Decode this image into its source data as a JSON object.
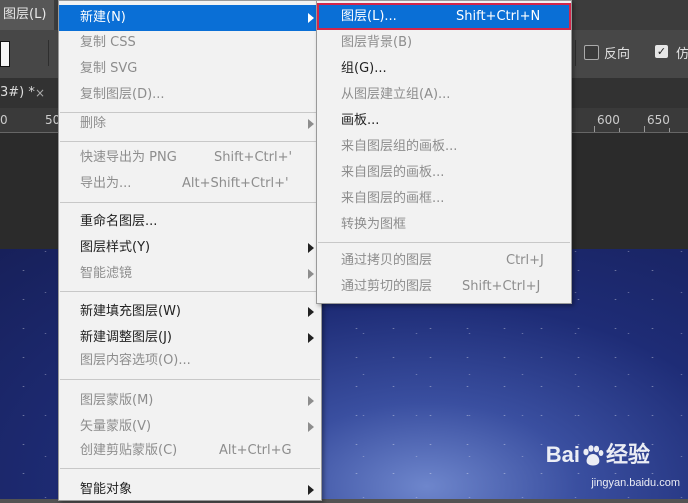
{
  "menubar": {
    "layer_menu": "图层(L)"
  },
  "options_bar": {
    "reverse_label": "反向",
    "imitate_label": "仿"
  },
  "document_tab": {
    "title": "3#) *",
    "close": "×"
  },
  "ruler": {
    "labels": [
      "0",
      "50",
      "600",
      "650"
    ]
  },
  "main_menu": {
    "items": [
      {
        "label": "新建(N)",
        "shortcut": "",
        "submenu": true,
        "disabled": false
      },
      {
        "label": "复制 CSS",
        "shortcut": "",
        "submenu": false,
        "disabled": true
      },
      {
        "label": "复制 SVG",
        "shortcut": "",
        "submenu": false,
        "disabled": true
      },
      {
        "label": "复制图层(D)...",
        "shortcut": "",
        "submenu": false,
        "disabled": true
      },
      {
        "label": "删除",
        "shortcut": "",
        "submenu": true,
        "disabled": true
      },
      {
        "label": "快速导出为 PNG",
        "shortcut": "Shift+Ctrl+'",
        "submenu": false,
        "disabled": true
      },
      {
        "label": "导出为...",
        "shortcut": "Alt+Shift+Ctrl+'",
        "submenu": false,
        "disabled": true
      },
      {
        "label": "重命名图层...",
        "shortcut": "",
        "submenu": false,
        "disabled": false
      },
      {
        "label": "图层样式(Y)",
        "shortcut": "",
        "submenu": true,
        "disabled": false
      },
      {
        "label": "智能滤镜",
        "shortcut": "",
        "submenu": true,
        "disabled": true
      },
      {
        "label": "新建填充图层(W)",
        "shortcut": "",
        "submenu": true,
        "disabled": false
      },
      {
        "label": "新建调整图层(J)",
        "shortcut": "",
        "submenu": true,
        "disabled": false
      },
      {
        "label": "图层内容选项(O)...",
        "shortcut": "",
        "submenu": false,
        "disabled": true
      },
      {
        "label": "图层蒙版(M)",
        "shortcut": "",
        "submenu": true,
        "disabled": true
      },
      {
        "label": "矢量蒙版(V)",
        "shortcut": "",
        "submenu": true,
        "disabled": true
      },
      {
        "label": "创建剪贴蒙版(C)",
        "shortcut": "Alt+Ctrl+G",
        "submenu": false,
        "disabled": true
      },
      {
        "label": "智能对象",
        "shortcut": "",
        "submenu": true,
        "disabled": false
      }
    ]
  },
  "sub_menu": {
    "items": [
      {
        "label": "图层(L)...",
        "shortcut": "Shift+Ctrl+N",
        "disabled": false
      },
      {
        "label": "图层背景(B)",
        "shortcut": "",
        "disabled": true
      },
      {
        "label": "组(G)...",
        "shortcut": "",
        "disabled": false
      },
      {
        "label": "从图层建立组(A)...",
        "shortcut": "",
        "disabled": true
      },
      {
        "label": "画板...",
        "shortcut": "",
        "disabled": false
      },
      {
        "label": "来自图层组的画板...",
        "shortcut": "",
        "disabled": true
      },
      {
        "label": "来自图层的画板...",
        "shortcut": "",
        "disabled": true
      },
      {
        "label": "来自图层的画框...",
        "shortcut": "",
        "disabled": true
      },
      {
        "label": "转换为图框",
        "shortcut": "",
        "disabled": true
      },
      {
        "label": "通过拷贝的图层",
        "shortcut": "Ctrl+J",
        "disabled": true
      },
      {
        "label": "通过剪切的图层",
        "shortcut": "Shift+Ctrl+J",
        "disabled": true
      }
    ]
  },
  "watermark": {
    "brand_left": "Bai",
    "brand_right": "经验",
    "url": "jingyan.baidu.com"
  },
  "colors": {
    "highlight": "#0a6fd6",
    "outline": "#d2264a",
    "menu_bg": "#f2f2f2",
    "disabled_text": "#8d8d8d"
  }
}
